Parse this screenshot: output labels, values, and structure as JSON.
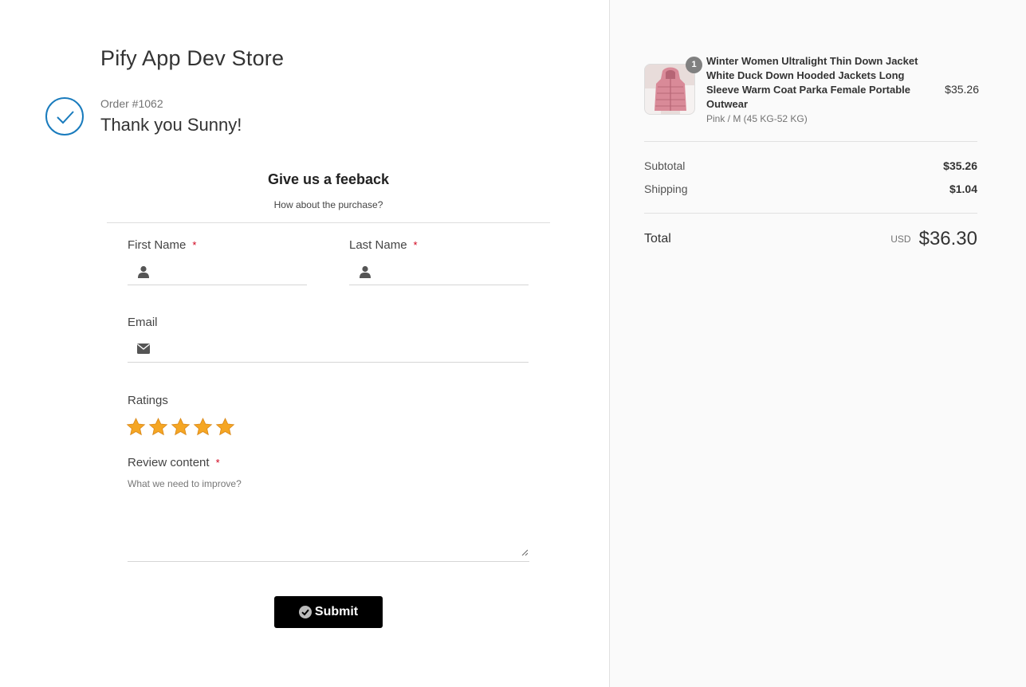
{
  "store": {
    "name": "Pify App Dev Store"
  },
  "order": {
    "number": "Order #1062",
    "thank_you": "Thank you Sunny!"
  },
  "feedback": {
    "title": "Give us a feeback",
    "subtitle": "How about the purchase?",
    "first_name_label": "First Name",
    "last_name_label": "Last Name",
    "email_label": "Email",
    "ratings_label": "Ratings",
    "rating": 5,
    "review_label": "Review content",
    "review_placeholder": "What we need to improve?",
    "required_mark": "*",
    "submit_label": "Submit"
  },
  "cart": {
    "item": {
      "quantity": "1",
      "name": "Winter Women Ultralight Thin Down Jacket White Duck Down Hooded Jackets Long Sleeve Warm Coat Parka Female Portable Outwear",
      "variant": "Pink / M (45 KG-52 KG)",
      "price": "$35.26"
    },
    "subtotal_label": "Subtotal",
    "subtotal_value": "$35.26",
    "shipping_label": "Shipping",
    "shipping_value": "$1.04",
    "total_label": "Total",
    "currency": "USD",
    "total_value": "$36.30"
  },
  "colors": {
    "accent": "#197bbd",
    "star": "#f5a623",
    "required": "#d0021b",
    "button": "#000000"
  }
}
